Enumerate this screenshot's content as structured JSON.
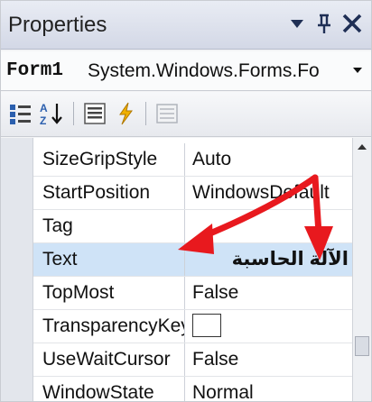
{
  "title_bar": {
    "title": "Properties",
    "dropdown_icon": "▼",
    "pin_icon": "ᵖ",
    "close_icon": "✕"
  },
  "object_selector": {
    "name": "Form1",
    "type": "System.Windows.Forms.Fo",
    "dropdown_icon": "▾"
  },
  "toolbar": {
    "buttons": [
      "categorized-icon",
      "alphabetical-icon",
      "properties-icon",
      "events-icon",
      "property-pages-icon"
    ]
  },
  "properties": [
    {
      "name": "SizeGripStyle",
      "value": "Auto"
    },
    {
      "name": "StartPosition",
      "value": "WindowsDefault"
    },
    {
      "name": "Tag",
      "value": ""
    },
    {
      "name": "Text",
      "value": "الآلة الحاسبة",
      "selected": true
    },
    {
      "name": "TopMost",
      "value": "False"
    },
    {
      "name": "TransparencyKey",
      "value": ""
    },
    {
      "name": "UseWaitCursor",
      "value": "False"
    },
    {
      "name": "WindowState",
      "value": "Normal"
    }
  ],
  "colors": {
    "selected_row": "#cfe3f7",
    "arrow": "#e8191e",
    "transparency_key_swatch": "#ffffff"
  }
}
